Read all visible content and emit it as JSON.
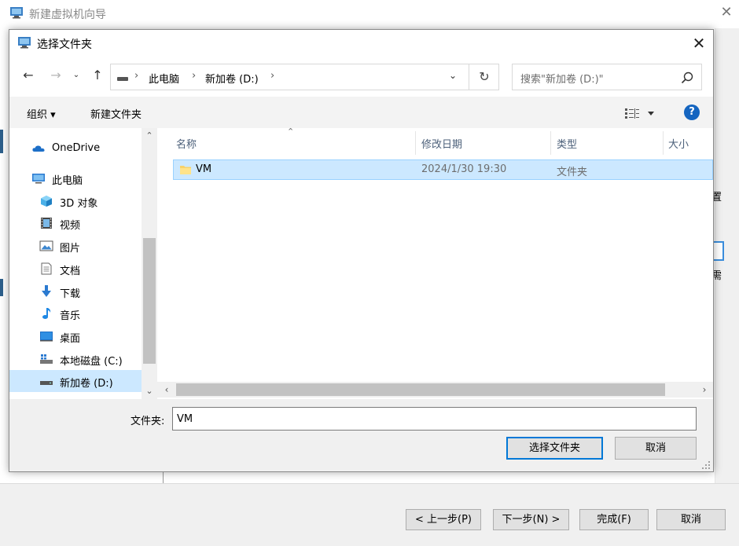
{
  "wizard": {
    "title": "新建虚拟机向导",
    "right_char_1": "置",
    "right_char_2": "需",
    "buttons": {
      "back": "< 上一步(P)",
      "next": "下一步(N) >",
      "finish": "完成(F)",
      "cancel": "取消"
    }
  },
  "dialog": {
    "title": "选择文件夹",
    "address": {
      "segments": [
        "此电脑",
        "新加卷 (D:)"
      ]
    },
    "search": {
      "placeholder": "搜索\"新加卷 (D:)\""
    },
    "toolbar": {
      "organize": "组织 ▾",
      "new_folder": "新建文件夹",
      "help": "?"
    },
    "nav": {
      "items": [
        {
          "label": "OneDrive",
          "icon": "cloud-icon"
        },
        {
          "label": "此电脑",
          "icon": "computer-icon"
        },
        {
          "label": "3D 对象",
          "icon": "cube-icon"
        },
        {
          "label": "视频",
          "icon": "video-icon"
        },
        {
          "label": "图片",
          "icon": "picture-icon"
        },
        {
          "label": "文档",
          "icon": "document-icon"
        },
        {
          "label": "下载",
          "icon": "download-icon"
        },
        {
          "label": "音乐",
          "icon": "music-icon"
        },
        {
          "label": "桌面",
          "icon": "desktop-icon"
        },
        {
          "label": "本地磁盘 (C:)",
          "icon": "local-disk-icon"
        },
        {
          "label": "新加卷 (D:)",
          "icon": "drive-icon",
          "selected": true
        }
      ]
    },
    "columns": {
      "name": "名称",
      "modified": "修改日期",
      "type": "类型",
      "size": "大小"
    },
    "files": [
      {
        "name": "VM",
        "modified": "2024/1/30 19:30",
        "type": "文件夹"
      }
    ],
    "folder_field": {
      "label": "文件夹:",
      "value": "VM"
    },
    "buttons": {
      "select": "选择文件夹",
      "cancel": "取消"
    },
    "colors": {
      "selection": "#cce8ff",
      "accent": "#0078d7"
    }
  }
}
